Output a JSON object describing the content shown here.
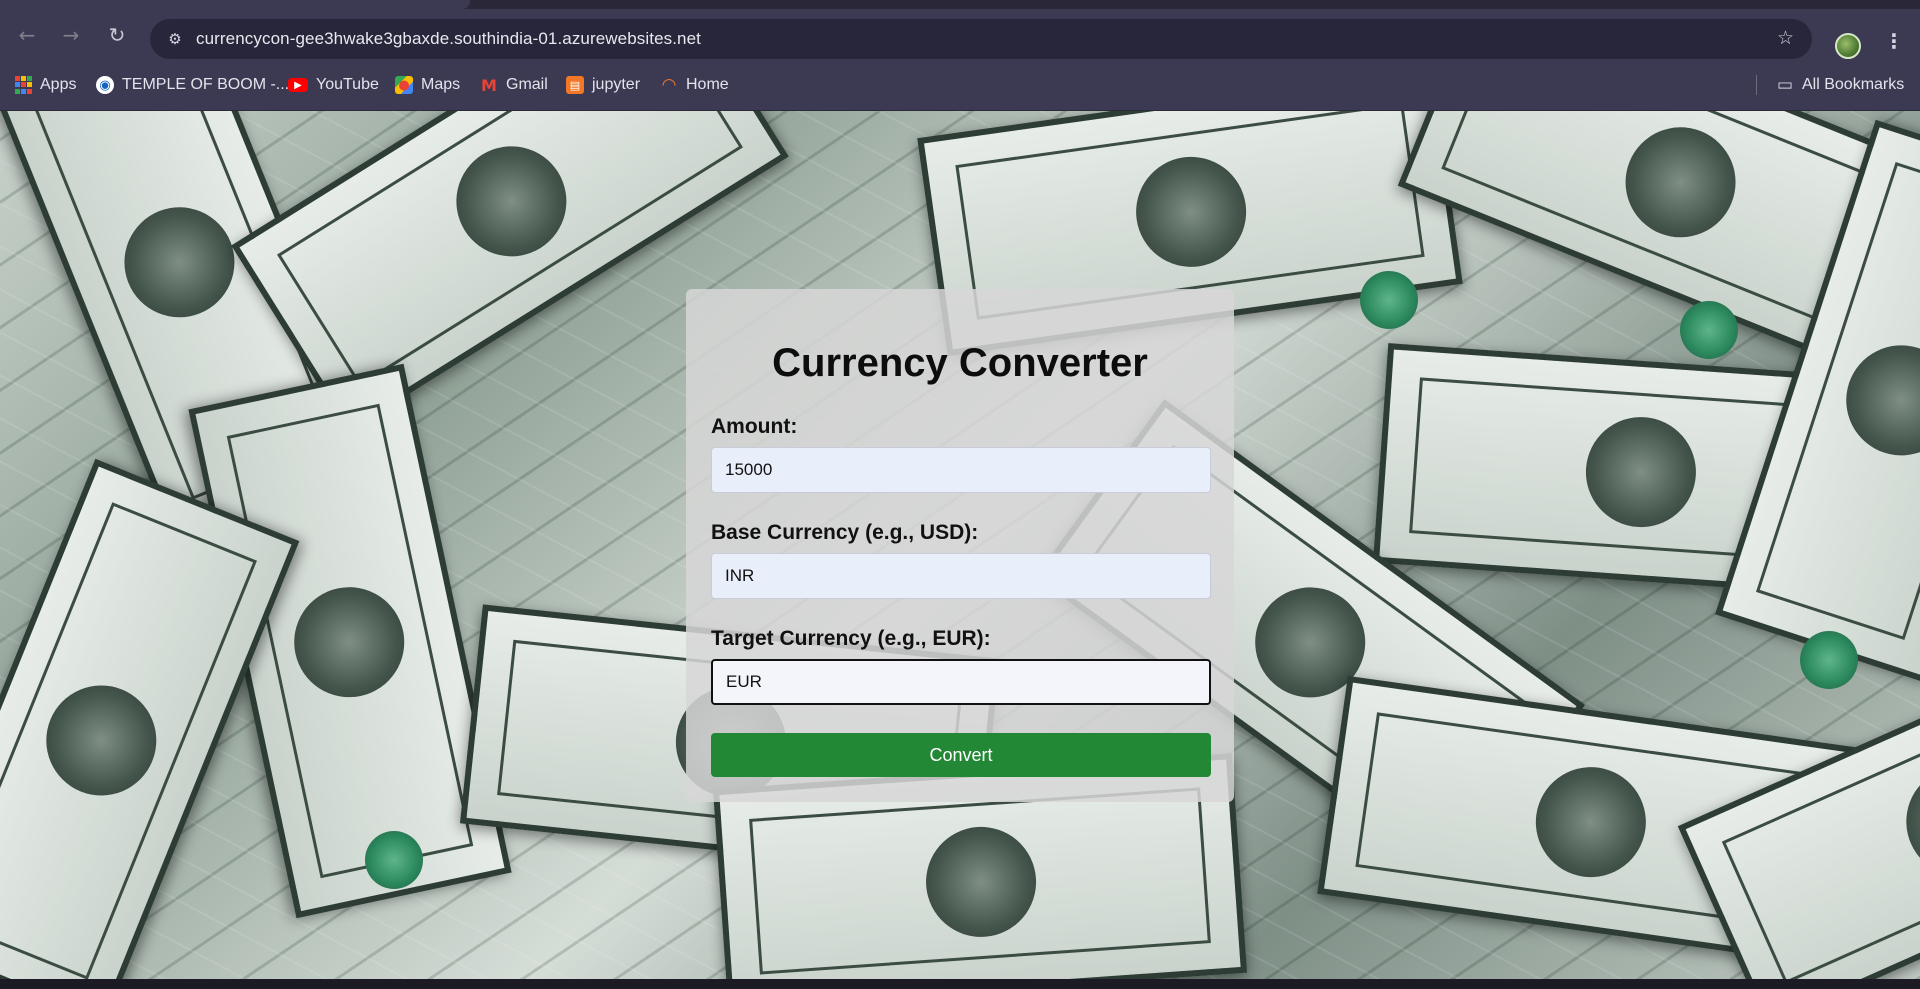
{
  "browser": {
    "url": "currencycon-gee3hwake3gbaxde.southindia-01.azurewebsites.net",
    "bookmarks": [
      {
        "label": "Apps",
        "icon": "apps-grid-icon"
      },
      {
        "label": "TEMPLE OF BOOM -...",
        "icon": "temple-of-boom-icon"
      },
      {
        "label": "YouTube",
        "icon": "youtube-icon"
      },
      {
        "label": "Maps",
        "icon": "maps-icon"
      },
      {
        "label": "Gmail",
        "icon": "gmail-icon"
      },
      {
        "label": "jupyter",
        "icon": "jupyter-icon"
      },
      {
        "label": "Home",
        "icon": "home-site-icon"
      }
    ],
    "all_bookmarks_label": "All Bookmarks"
  },
  "converter": {
    "title": "Currency Converter",
    "amount_label": "Amount:",
    "amount_value": "15000",
    "base_label": "Base Currency (e.g., USD):",
    "base_value": "INR",
    "target_label": "Target Currency (e.g., EUR):",
    "target_value": "EUR",
    "convert_label": "Convert"
  },
  "colors": {
    "accent_button": "#228836",
    "card_background": "#d6d6d6",
    "browser_chrome": "#3c3a52"
  }
}
